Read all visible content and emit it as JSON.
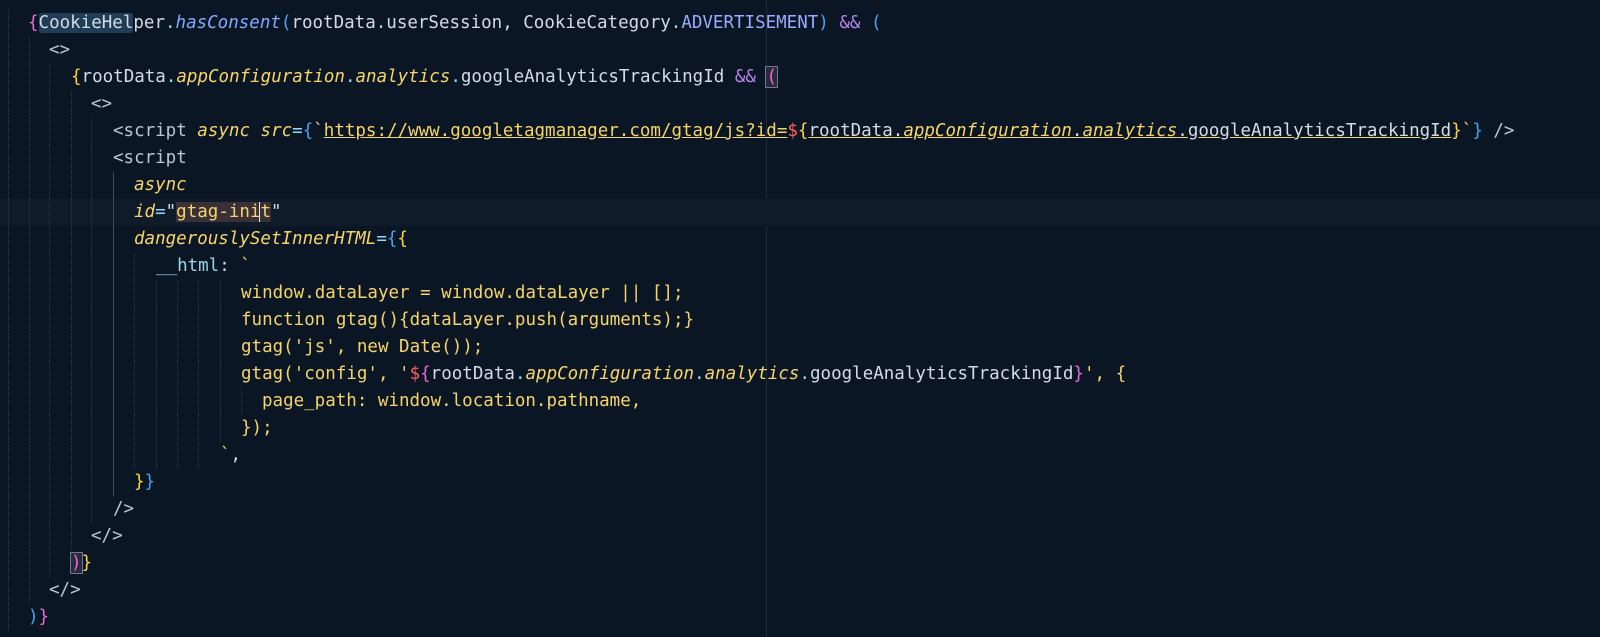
{
  "editor": {
    "language": "tsx",
    "lines": [
      "{CookieHelper.hasConsent(rootData.userSession, CookieCategory.ADVERTISEMENT) && (",
      "  <>",
      "    {rootData.appConfiguration.analytics.googleAnalyticsTrackingId && (",
      "      <>",
      "        <script async src={`https://www.googletagmanager.com/gtag/js?id=${rootData.appConfiguration.analytics.googleAnalyticsTrackingId}`} />",
      "        <script",
      "          async",
      "          id=\"gtag-init\"",
      "          dangerouslySetInnerHTML={{",
      "            __html: `",
      "                window.dataLayer = window.dataLayer || [];",
      "                function gtag(){dataLayer.push(arguments);}",
      "                gtag('js', new Date());",
      "                gtag('config', '${rootData.appConfiguration.analytics.googleAnalyticsTrackingId}', {",
      "                  page_path: window.location.pathname,",
      "                });",
      "              `,",
      "          }}",
      "        />",
      "      </>",
      "    )}",
      "  </>",
      ")}"
    ]
  },
  "tokens": {
    "l0": {
      "open": "{",
      "cookie_hl": "CookieHel",
      "cookie_rest": "per",
      "dot1": ".",
      "method": "hasConsent",
      "paren": "(",
      "arg1": "rootData",
      "dot2": ".",
      "arg1b": "userSession",
      "comma": ", ",
      "arg2": "CookieCategory",
      "dot3": ".",
      "enum": "ADVERTISEMENT",
      "close": ")",
      "and": " && ",
      "paren2": "("
    },
    "l1": {
      "frag": "<>"
    },
    "l2": {
      "open": "{",
      "root": "rootData",
      "d1": ".",
      "cfg": "appConfiguration",
      "d2": ".",
      "an": "analytics",
      "d3": ".",
      "id": "googleAnalyticsTrackingId",
      "and": " && ",
      "paren": "("
    },
    "l3": {
      "frag": "<>"
    },
    "l4": {
      "tag": "<script ",
      "async": "async",
      "sp": " ",
      "src": "src",
      "eq": "=",
      "lb": "{",
      "bt": "`",
      "url": "https://www.googletagmanager.com/gtag/js?id=",
      "dollar": "$",
      "ib": "{",
      "root": "rootData",
      "d1": ".",
      "cfg": "appConfiguration",
      "d2": ".",
      "an": "analytics",
      "d3": ".",
      "id": "googleAnalyticsTrackingId",
      "ie": "}",
      "bt2": "`",
      "rb": "}",
      "end": " />"
    },
    "l5": {
      "tag": "<script"
    },
    "l6": {
      "async": "async"
    },
    "l7": {
      "attr": "id",
      "eq": "=",
      "q1": "\"",
      "val_a": "gtag-ini",
      "val_b": "t",
      "q2": "\""
    },
    "l8": {
      "attr": "dangerouslySetInnerHTML",
      "eq": "=",
      "b1": "{",
      "b2": "{"
    },
    "l9": {
      "key": "__html",
      "colon": ": ",
      "bt": "`"
    },
    "l10": {
      "code": "window.dataLayer = window.dataLayer || [];"
    },
    "l11": {
      "code": "function gtag(){dataLayer.push(arguments);}"
    },
    "l12": {
      "code": "gtag('js', new Date());"
    },
    "l13": {
      "pre": "gtag('config', '",
      "dollar": "$",
      "ib": "{",
      "root": "rootData",
      "d1": ".",
      "cfg": "appConfiguration",
      "d2": ".",
      "an": "analytics",
      "d3": ".",
      "id": "googleAnalyticsTrackingId",
      "ie": "}",
      "post": "', {"
    },
    "l14": {
      "code": "page_path: window.location.pathname,"
    },
    "l15": {
      "code": "});"
    },
    "l16": {
      "bt": "`",
      "comma": ","
    },
    "l17": {
      "b1": "}",
      "b2": "}"
    },
    "l18": {
      "close": "/>"
    },
    "l19": {
      "frag": "</>"
    },
    "l20": {
      "paren": ")",
      "brace": "}"
    },
    "l21": {
      "frag": "</>"
    },
    "l22": {
      "paren": ")",
      "brace": "}"
    }
  },
  "colors": {
    "background": "#0b1624",
    "brace_yellow": "#ffd43b",
    "brace_pink": "#e86ad8",
    "brace_blue": "#4aa3f0",
    "attr": "#f6d46b"
  }
}
